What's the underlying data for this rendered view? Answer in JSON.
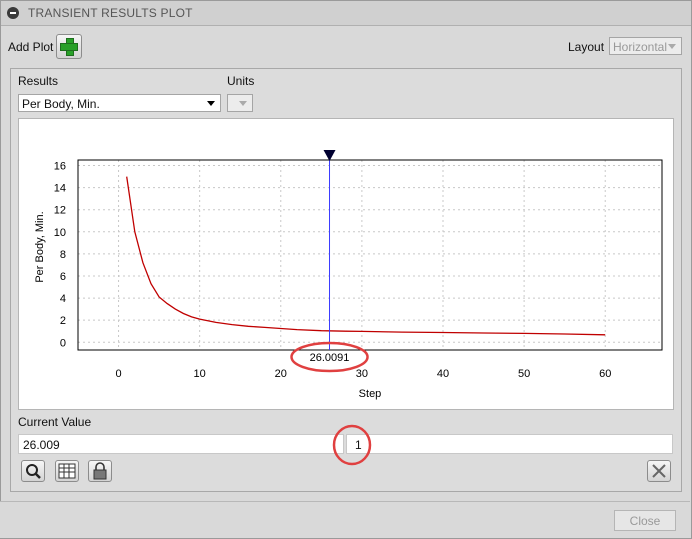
{
  "window": {
    "title": "TRANSIENT RESULTS PLOT"
  },
  "toolbar": {
    "add_plot_label": "Add Plot",
    "layout_label": "Layout",
    "layout_value": "Horizontal"
  },
  "results": {
    "label": "Results",
    "value": "Per Body, Min."
  },
  "units": {
    "label": "Units",
    "value": ""
  },
  "chart_data": {
    "type": "line",
    "xlabel": "Step",
    "ylabel": "Per Body,  Min.",
    "xlim": [
      -5,
      67
    ],
    "ylim": [
      -0.7,
      16.5
    ],
    "x_ticks": [
      0,
      10,
      20,
      30,
      40,
      50,
      60
    ],
    "y_ticks": [
      0,
      2,
      4,
      6,
      8,
      10,
      12,
      14,
      16
    ],
    "grid": true,
    "cursor_x": 26.0091,
    "cursor_label": "26.0091",
    "series": [
      {
        "color": "#c00000",
        "x": [
          1,
          2,
          3,
          4,
          5,
          6,
          7,
          8,
          9,
          10,
          12,
          14,
          16,
          18,
          20,
          22,
          25,
          28,
          30,
          35,
          40,
          45,
          50,
          55,
          60
        ],
        "y": [
          15.0,
          10.0,
          7.2,
          5.3,
          4.1,
          3.5,
          3.0,
          2.6,
          2.3,
          2.1,
          1.8,
          1.6,
          1.45,
          1.35,
          1.25,
          1.15,
          1.05,
          1.0,
          0.98,
          0.92,
          0.88,
          0.84,
          0.8,
          0.75,
          0.68
        ]
      }
    ]
  },
  "current_value": {
    "label": "Current Value",
    "value": "26.009",
    "step": "1"
  },
  "icons": {
    "zoom": "zoom-icon",
    "table": "table-icon",
    "lock": "lock-icon",
    "clear": "clear-icon",
    "add": "plus-icon",
    "collapse": "collapse-icon"
  },
  "footer": {
    "close_label": "Close"
  }
}
